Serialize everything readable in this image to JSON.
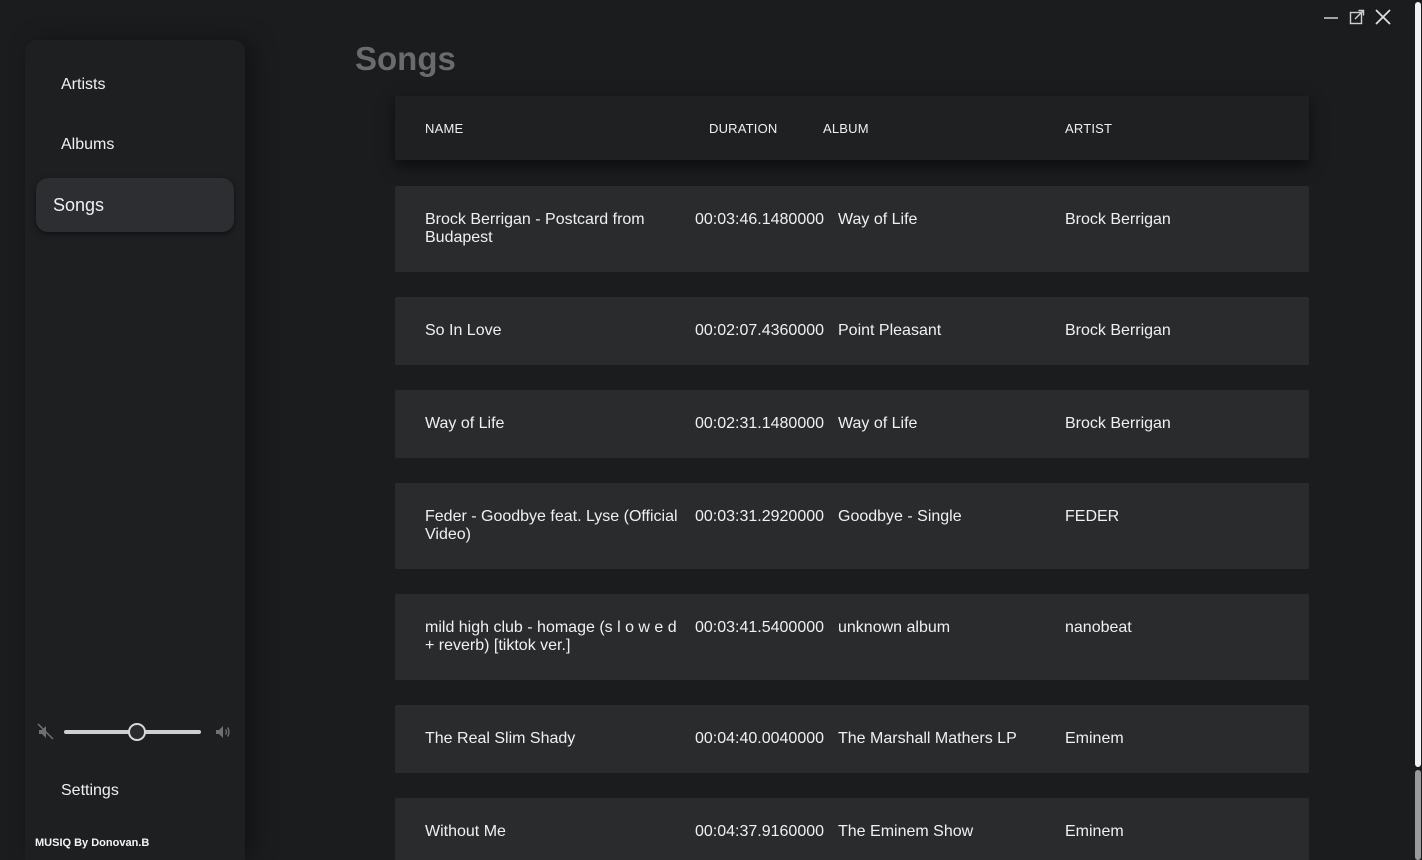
{
  "sidebar": {
    "items": [
      {
        "label": "Artists"
      },
      {
        "label": "Albums"
      },
      {
        "label": "Songs",
        "selected": true
      }
    ],
    "volume": 0.53,
    "settings_label": "Settings",
    "brand": "MUSIQ By Donovan.B"
  },
  "main": {
    "title": "Songs",
    "columns": [
      "NAME",
      "DURATION",
      "ALBUM",
      "ARTIST"
    ],
    "rows": [
      {
        "name": "Brock Berrigan - Postcard from Budapest",
        "duration": "00:03:46.1480000",
        "album": "Way of Life",
        "artist": "Brock Berrigan"
      },
      {
        "name": "So In Love",
        "duration": "00:02:07.4360000",
        "album": "Point Pleasant",
        "artist": "Brock Berrigan"
      },
      {
        "name": "Way of Life",
        "duration": "00:02:31.1480000",
        "album": "Way of Life",
        "artist": "Brock Berrigan"
      },
      {
        "name": "Feder - Goodbye feat. Lyse (Official Video)",
        "duration": "00:03:31.2920000",
        "album": "Goodbye - Single",
        "artist": "FEDER"
      },
      {
        "name": "mild high club - homage (s l o w e d + reverb) [tiktok ver.]",
        "duration": "00:03:41.5400000",
        "album": "unknown album",
        "artist": "nanobeat"
      },
      {
        "name": "The Real Slim Shady",
        "duration": "00:04:40.0040000",
        "album": "The Marshall Mathers LP",
        "artist": "Eminem"
      },
      {
        "name": "Without Me",
        "duration": "00:04:37.9160000",
        "album": "The Eminem Show",
        "artist": "Eminem"
      }
    ]
  },
  "icons": {
    "mute": "speaker-mute-icon",
    "volume": "speaker-icon",
    "minimize": "minimize-icon",
    "popout": "popout-icon",
    "close": "close-icon"
  },
  "colors": {
    "background": "#1b1c1e",
    "row": "#2a2b2d",
    "selected_nav": "#2c2e31",
    "title": "#6a6b6d"
  }
}
